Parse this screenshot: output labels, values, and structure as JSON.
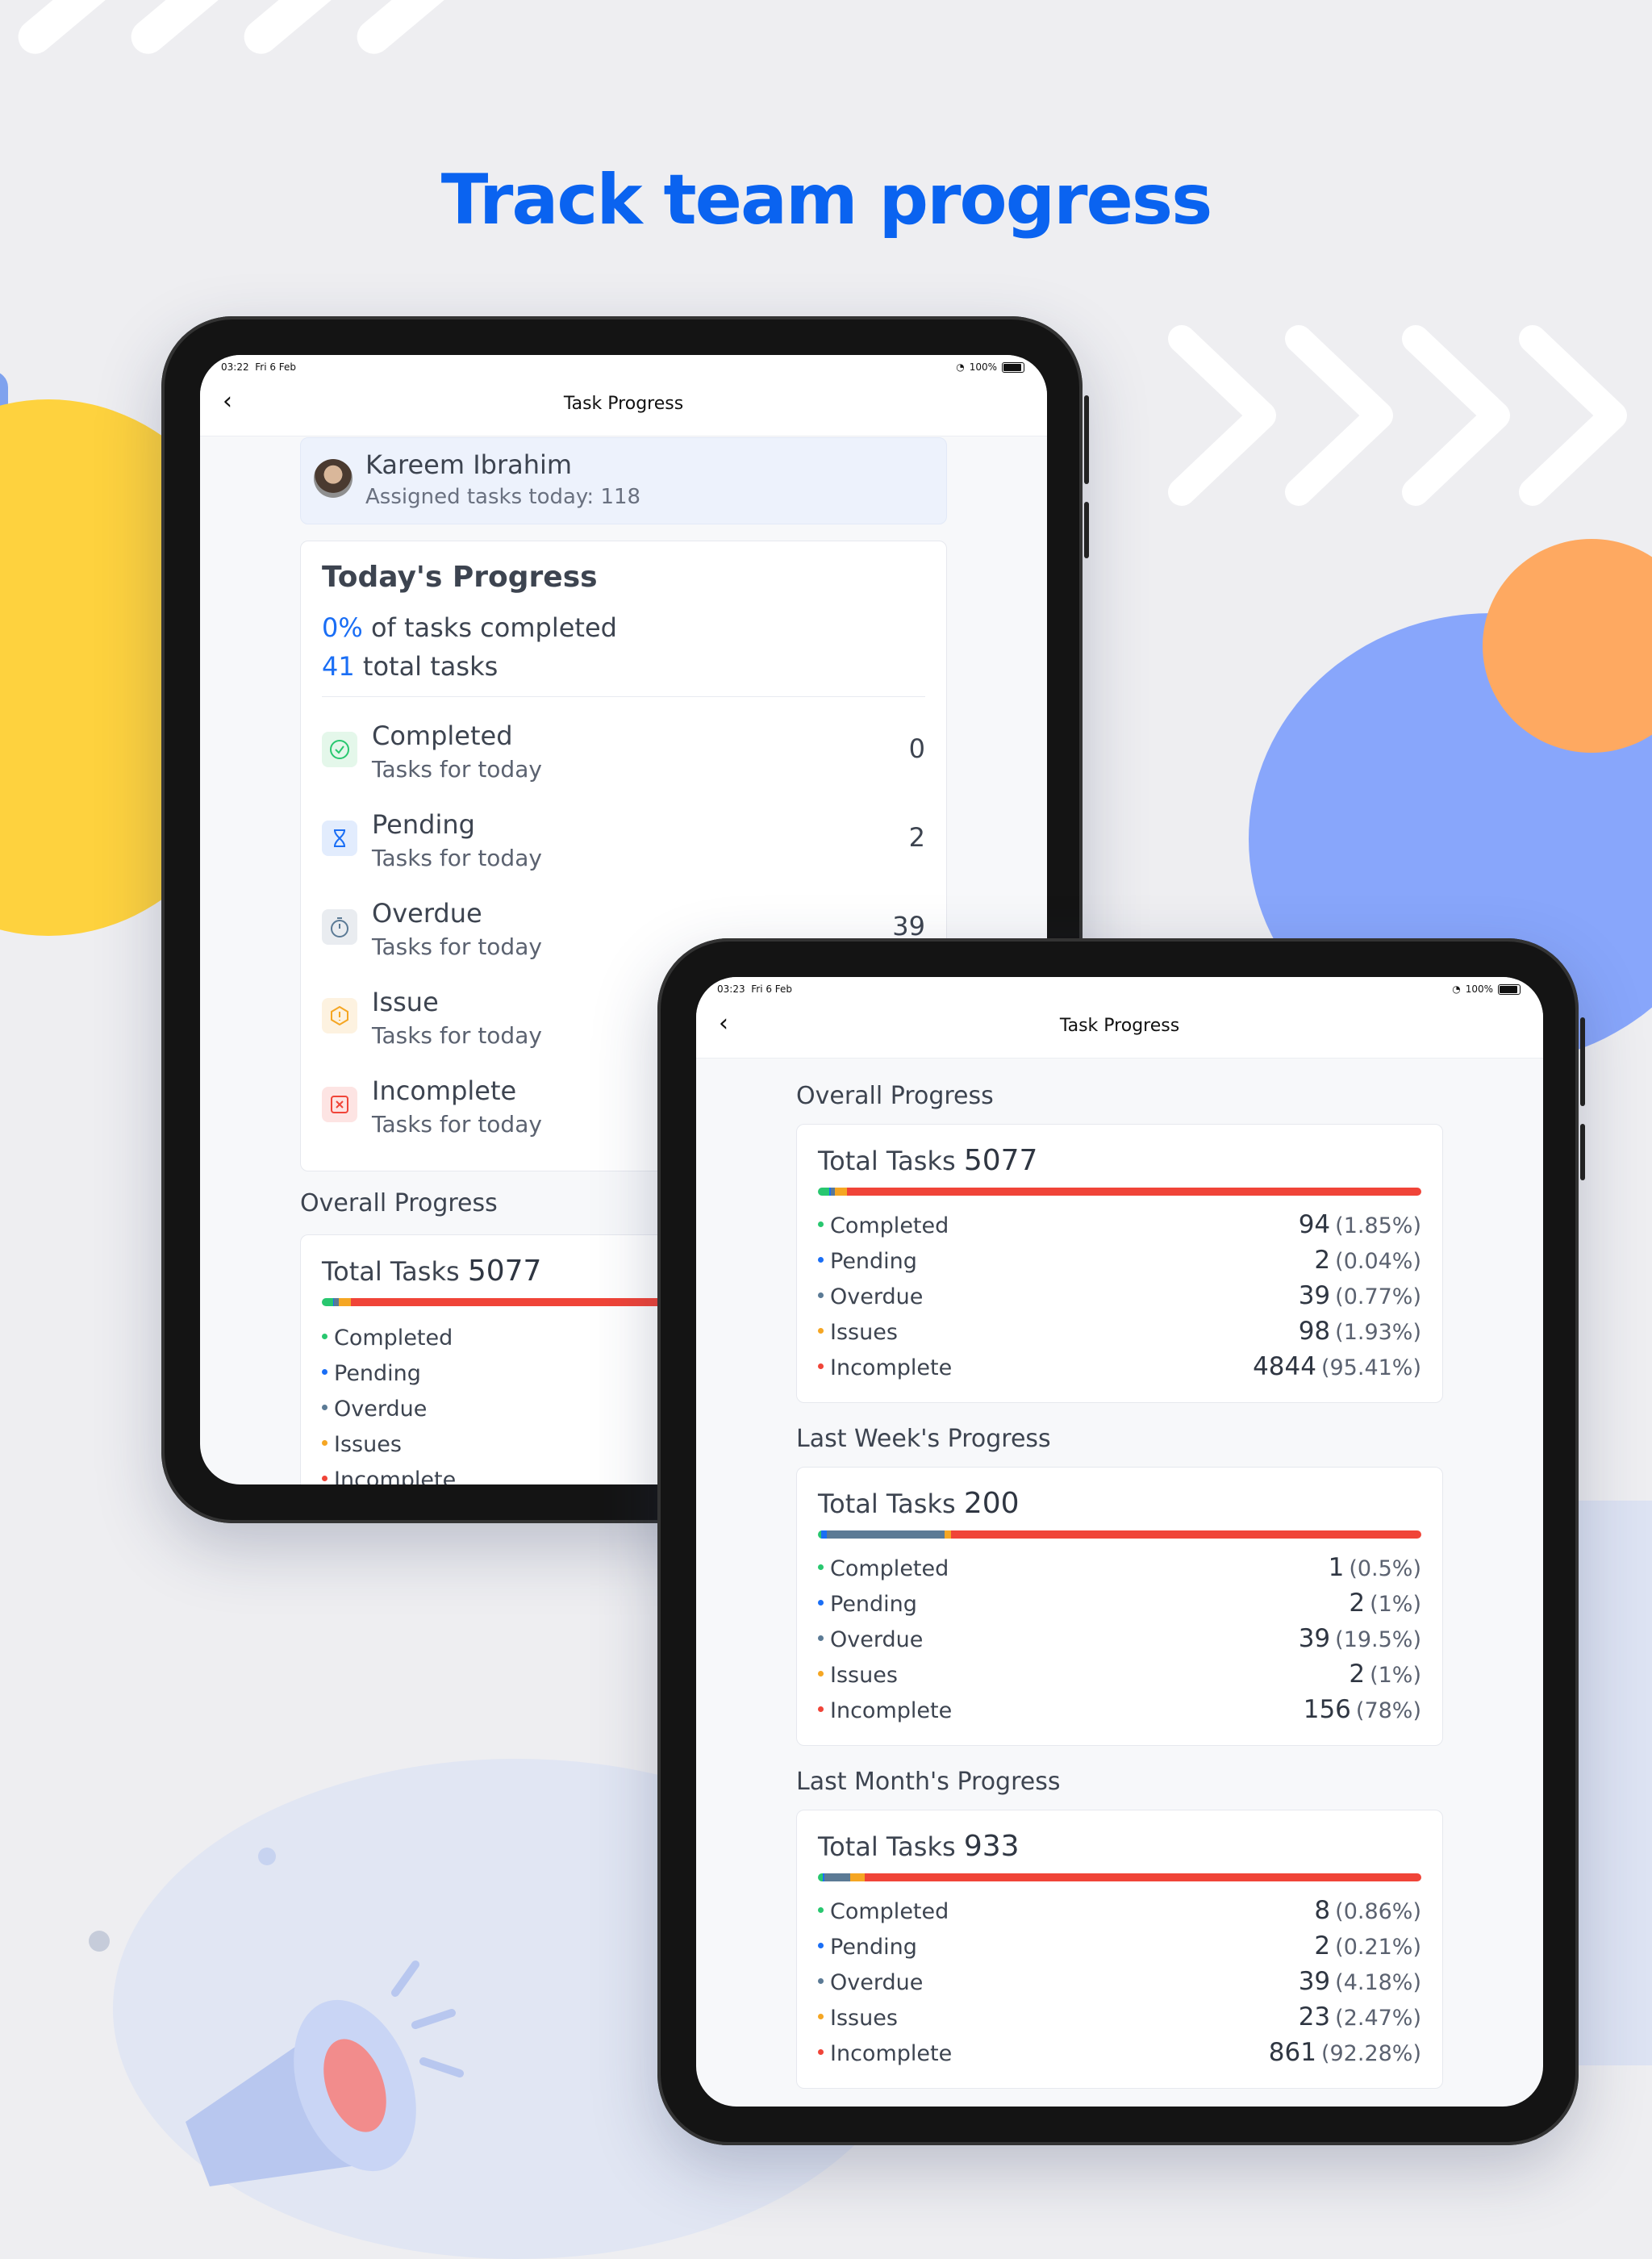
{
  "headline": "Track team progress",
  "colors": {
    "completed": "#28c76f",
    "pending": "#1a6ef5",
    "overdue": "#5b7a95",
    "issues": "#f5a623",
    "incomplete": "#f04438",
    "brand": "#0a63f0"
  },
  "tablet_back": {
    "status": {
      "time": "03:22",
      "date": "Fri 6 Feb",
      "battery": "100%"
    },
    "nav_title": "Task Progress",
    "user": {
      "name": "Kareem Ibrahim",
      "assigned": "Assigned tasks today: 118"
    },
    "today": {
      "title": "Today's Progress",
      "percent": "0%",
      "percent_suffix": " of tasks completed",
      "total": "41",
      "total_suffix": " total tasks",
      "items": [
        {
          "name": "Completed",
          "sub": "Tasks for today",
          "count": "0",
          "icon": "check-circle-icon"
        },
        {
          "name": "Pending",
          "sub": "Tasks for today",
          "count": "2",
          "icon": "hourglass-icon"
        },
        {
          "name": "Overdue",
          "sub": "Tasks for today",
          "count": "39",
          "icon": "stopwatch-icon"
        },
        {
          "name": "Issue",
          "sub": "Tasks for today",
          "count": "",
          "icon": "warning-icon"
        },
        {
          "name": "Incomplete",
          "sub": "Tasks for today",
          "count": "",
          "icon": "x-square-icon"
        }
      ]
    },
    "overall": {
      "title": "Overall Progress",
      "total_label": "Total Tasks",
      "total": "5077",
      "items": [
        "Completed",
        "Pending",
        "Overdue",
        "Issues",
        "Incomplete"
      ]
    }
  },
  "tablet_front": {
    "status": {
      "time": "03:23",
      "date": "Fri 6 Feb",
      "battery": "100%"
    },
    "nav_title": "Task Progress",
    "sections": [
      {
        "title": "Overall Progress",
        "total_label": "Total Tasks",
        "total": "5077",
        "rows": [
          {
            "name": "Completed",
            "value": "94",
            "pct": "(1.85%)",
            "fraction": 0.0185
          },
          {
            "name": "Pending",
            "value": "2",
            "pct": "(0.04%)",
            "fraction": 0.0004
          },
          {
            "name": "Overdue",
            "value": "39",
            "pct": "(0.77%)",
            "fraction": 0.0077
          },
          {
            "name": "Issues",
            "value": "98",
            "pct": "(1.93%)",
            "fraction": 0.0193
          },
          {
            "name": "Incomplete",
            "value": "4844",
            "pct": "(95.41%)",
            "fraction": 0.9541
          }
        ]
      },
      {
        "title": "Last Week's Progress",
        "total_label": "Total Tasks",
        "total": "200",
        "rows": [
          {
            "name": "Completed",
            "value": "1",
            "pct": "(0.5%)",
            "fraction": 0.005
          },
          {
            "name": "Pending",
            "value": "2",
            "pct": "(1%)",
            "fraction": 0.01
          },
          {
            "name": "Overdue",
            "value": "39",
            "pct": "(19.5%)",
            "fraction": 0.195
          },
          {
            "name": "Issues",
            "value": "2",
            "pct": "(1%)",
            "fraction": 0.01
          },
          {
            "name": "Incomplete",
            "value": "156",
            "pct": "(78%)",
            "fraction": 0.78
          }
        ]
      },
      {
        "title": "Last Month's Progress",
        "total_label": "Total Tasks",
        "total": "933",
        "rows": [
          {
            "name": "Completed",
            "value": "8",
            "pct": "(0.86%)",
            "fraction": 0.0086
          },
          {
            "name": "Pending",
            "value": "2",
            "pct": "(0.21%)",
            "fraction": 0.0021
          },
          {
            "name": "Overdue",
            "value": "39",
            "pct": "(4.18%)",
            "fraction": 0.0418
          },
          {
            "name": "Issues",
            "value": "23",
            "pct": "(2.47%)",
            "fraction": 0.0247
          },
          {
            "name": "Incomplete",
            "value": "861",
            "pct": "(92.28%)",
            "fraction": 0.9228
          }
        ]
      }
    ]
  }
}
